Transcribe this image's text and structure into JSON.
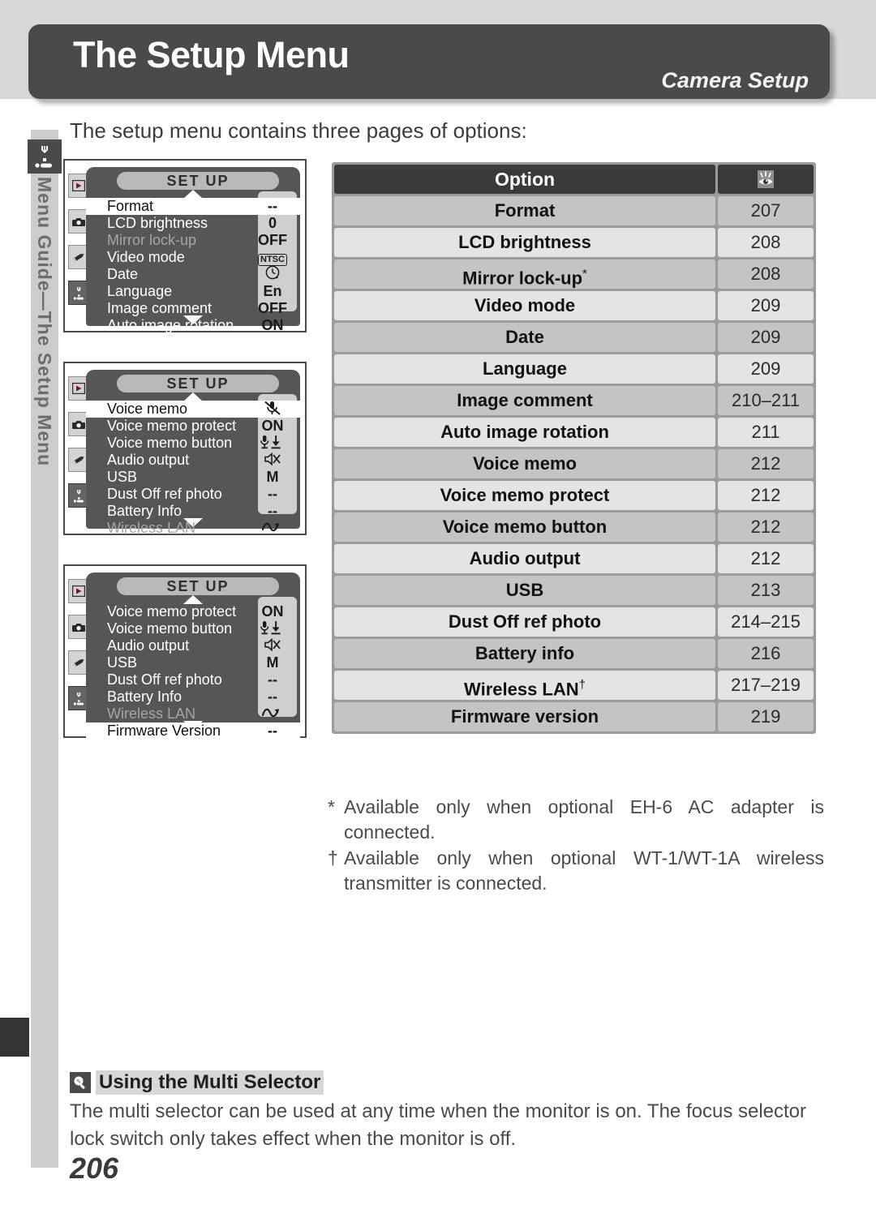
{
  "header": {
    "title": "The Setup Menu",
    "chapter": "Camera Setup",
    "sidebar_label": "Menu Guide—The Setup Menu",
    "sidebar_icon": "wrench-icon"
  },
  "intro": "The setup menu contains three pages of options:",
  "lcd_screens": [
    {
      "title": "SET UP",
      "tabs": [
        "playback-icon",
        "camera-icon",
        "pencil-icon",
        "wrench-icon"
      ],
      "selected_tab": "wrench-icon",
      "scroll_up": true,
      "scroll_down": true,
      "rows": [
        {
          "label": "Format",
          "value": "--",
          "state": "highlighted"
        },
        {
          "label": "LCD brightness",
          "value": "0",
          "state": "normal"
        },
        {
          "label": "Mirror lock-up",
          "value": "OFF",
          "state": "disabled"
        },
        {
          "label": "Video mode",
          "value": "NTSC",
          "state": "normal",
          "value_kind": "ntsc-badge"
        },
        {
          "label": "Date",
          "value": "clock-icon",
          "state": "normal",
          "value_kind": "icon"
        },
        {
          "label": "Language",
          "value": "En",
          "state": "normal"
        },
        {
          "label": "Image comment",
          "value": "OFF",
          "state": "normal"
        },
        {
          "label": "Auto image rotation",
          "value": "ON",
          "state": "normal"
        }
      ]
    },
    {
      "title": "SET UP",
      "tabs": [
        "playback-icon",
        "camera-icon",
        "pencil-icon",
        "wrench-icon"
      ],
      "selected_tab": "wrench-icon",
      "scroll_up": true,
      "scroll_down": true,
      "rows": [
        {
          "label": "Voice memo",
          "value": "mic-off-icon",
          "state": "highlighted",
          "value_kind": "icon"
        },
        {
          "label": "Voice memo protect",
          "value": "ON",
          "state": "normal"
        },
        {
          "label": "Voice memo button",
          "value": "mic-down-icon",
          "state": "normal",
          "value_kind": "icon"
        },
        {
          "label": "Audio output",
          "value": "speaker-off-icon",
          "state": "normal",
          "value_kind": "icon"
        },
        {
          "label": "USB",
          "value": "M",
          "state": "normal"
        },
        {
          "label": "Dust Off ref photo",
          "value": "--",
          "state": "normal"
        },
        {
          "label": "Battery Info",
          "value": "--",
          "state": "normal"
        },
        {
          "label": "Wireless LAN",
          "value": "wireless-icon",
          "state": "disabled",
          "value_kind": "icon"
        }
      ]
    },
    {
      "title": "SET UP",
      "tabs": [
        "playback-icon",
        "camera-icon",
        "pencil-icon",
        "wrench-icon"
      ],
      "selected_tab": "wrench-icon",
      "scroll_up": true,
      "scroll_down": true,
      "rows": [
        {
          "label": "Voice memo protect",
          "value": "ON",
          "state": "normal"
        },
        {
          "label": "Voice memo button",
          "value": "mic-down-icon",
          "state": "normal",
          "value_kind": "icon"
        },
        {
          "label": "Audio output",
          "value": "speaker-off-icon",
          "state": "normal",
          "value_kind": "icon"
        },
        {
          "label": "USB",
          "value": "M",
          "state": "normal"
        },
        {
          "label": "Dust Off ref photo",
          "value": "--",
          "state": "normal"
        },
        {
          "label": "Battery Info",
          "value": "--",
          "state": "normal"
        },
        {
          "label": "Wireless LAN",
          "value": "wireless-icon",
          "state": "disabled",
          "value_kind": "icon"
        },
        {
          "label": "Firmware Version",
          "value": "--",
          "state": "highlighted"
        }
      ]
    }
  ],
  "table": {
    "header": {
      "option": "Option",
      "page_icon": "see-page-eye-icon"
    },
    "rows": [
      {
        "option": "Format",
        "footnote": "",
        "page": "207"
      },
      {
        "option": "LCD brightness",
        "footnote": "",
        "page": "208"
      },
      {
        "option": "Mirror lock-up",
        "footnote": "*",
        "page": "208"
      },
      {
        "option": "Video mode",
        "footnote": "",
        "page": "209"
      },
      {
        "option": "Date",
        "footnote": "",
        "page": "209"
      },
      {
        "option": "Language",
        "footnote": "",
        "page": "209"
      },
      {
        "option": "Image comment",
        "footnote": "",
        "page": "210–211"
      },
      {
        "option": "Auto image rotation",
        "footnote": "",
        "page": "211"
      },
      {
        "option": "Voice memo",
        "footnote": "",
        "page": "212"
      },
      {
        "option": "Voice memo protect",
        "footnote": "",
        "page": "212"
      },
      {
        "option": "Voice memo button",
        "footnote": "",
        "page": "212"
      },
      {
        "option": "Audio output",
        "footnote": "",
        "page": "212"
      },
      {
        "option": "USB",
        "footnote": "",
        "page": "213"
      },
      {
        "option": "Dust Off ref photo",
        "footnote": "",
        "page": "214–215"
      },
      {
        "option": "Battery info",
        "footnote": "",
        "page": "216"
      },
      {
        "option": "Wireless LAN",
        "footnote": "†",
        "page": "217–219"
      },
      {
        "option": "Firmware version",
        "footnote": "",
        "page": "219"
      }
    ]
  },
  "footnotes": [
    {
      "mark": "*",
      "text": "Available only when optional EH-6 AC adapter is connected."
    },
    {
      "mark": "†",
      "text": "Available only when optional WT-1/WT-1A wireless transmitter is connected."
    }
  ],
  "tip": {
    "icon": "tip-magnifier-icon",
    "title": "Using the Multi Selector",
    "body": "The multi selector can be used at any time when the monitor is on.  The focus selector lock switch only takes effect when the monitor is off."
  },
  "folio": "206",
  "colors": {
    "banner": "#d8d8d8",
    "plate": "#4a4a4a",
    "table_header": "#3a3a3a",
    "row_odd": "#c4c4c4",
    "row_even": "#e4e4e4",
    "lcd_body": "#565656",
    "rail": "#cccccc"
  }
}
